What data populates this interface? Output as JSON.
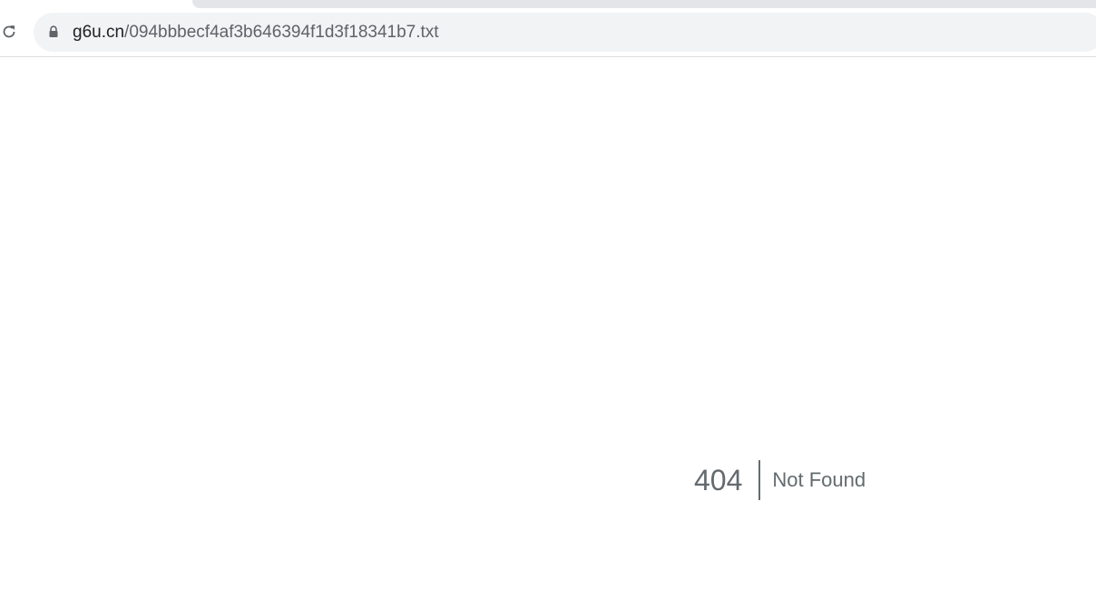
{
  "browser": {
    "address_bar": {
      "host": "g6u.cn",
      "path": "/094bbbecf4af3b646394f1d3f18341b7.txt"
    },
    "icons": {
      "reload": "reload-icon",
      "lock": "lock-icon"
    }
  },
  "page": {
    "error_code": "404",
    "error_message": "Not Found"
  },
  "colors": {
    "omnibox_bg": "#f1f3f4",
    "error_text": "#636b6f",
    "page_bg": "#ffffff"
  }
}
